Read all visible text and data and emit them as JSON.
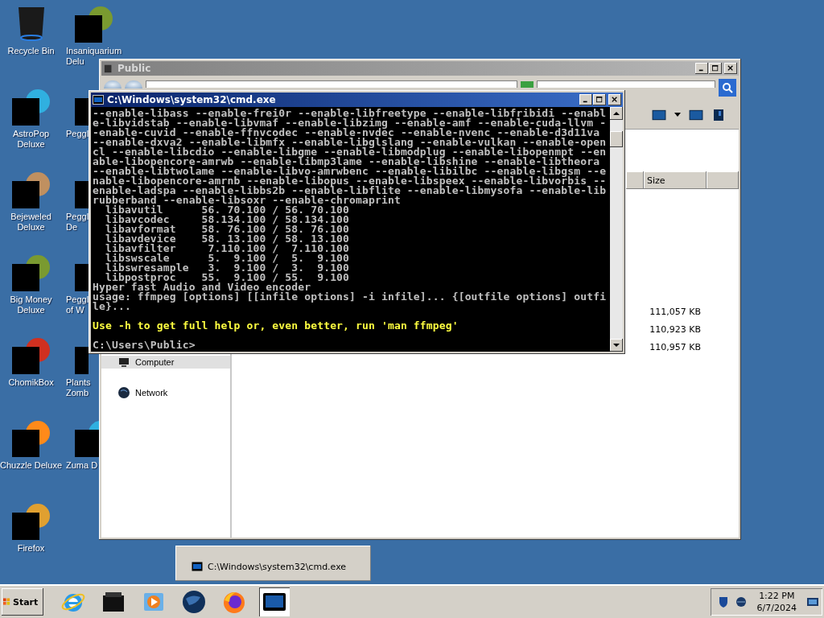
{
  "desktop_columns": [
    {
      "icons": [
        {
          "kind": "bin",
          "label": [
            "Recycle Bin"
          ]
        },
        {
          "kind": "redacted",
          "label": [
            "AstroPop",
            "Deluxe"
          ]
        },
        {
          "kind": "redacted",
          "label": [
            "Bejeweled",
            "Deluxe"
          ]
        },
        {
          "kind": "redacted",
          "label": [
            "Big Money",
            "Deluxe"
          ]
        },
        {
          "kind": "redacted",
          "label": [
            "ChomikBox"
          ]
        },
        {
          "kind": "redacted",
          "label": [
            "Chuzzle Deluxe"
          ]
        },
        {
          "kind": "redacted",
          "label": [
            "Firefox"
          ]
        }
      ]
    },
    {
      "icons": [
        {
          "kind": "redacted",
          "label": [
            "Insaniquarium",
            "Delu"
          ]
        },
        {
          "kind": "redacted",
          "label": [
            "Peggl"
          ]
        },
        {
          "kind": "redacted",
          "label": [
            "Peggl",
            "De"
          ]
        },
        {
          "kind": "redacted",
          "label": [
            "Peggl",
            "of W"
          ]
        },
        {
          "kind": "redacted",
          "label": [
            "Plants",
            "Zomb"
          ]
        },
        {
          "kind": "redacted",
          "label": [
            "Zuma D"
          ]
        }
      ]
    }
  ],
  "explorer": {
    "title": "Public",
    "active": false,
    "nav": [
      {
        "label": "Computer",
        "selected": true
      },
      {
        "label": "Network",
        "selected": false
      }
    ],
    "columns": [
      {
        "label": "Size"
      }
    ],
    "rows": [
      {
        "size": "111,057 KB"
      },
      {
        "size": "110,923 KB"
      },
      {
        "size": "110,957 KB"
      }
    ]
  },
  "cmd": {
    "title": "C:\\Windows\\system32\\cmd.exe",
    "active": true,
    "lines": [
      {
        "kind": "output",
        "text": "--enable-libass --enable-frei0r --enable-libfreetype --enable-libfribidi --enabl"
      },
      {
        "kind": "output",
        "text": "e-libvidstab --enable-libvmaf --enable-libzimg --enable-amf --enable-cuda-llvm -"
      },
      {
        "kind": "output",
        "text": "-enable-cuvid --enable-ffnvcodec --enable-nvdec --enable-nvenc --enable-d3d11va"
      },
      {
        "kind": "output",
        "text": "--enable-dxva2 --enable-libmfx --enable-libglslang --enable-vulkan --enable-open"
      },
      {
        "kind": "output",
        "text": "cl --enable-libcdio --enable-libgme --enable-libmodplug --enable-libopenmpt --en"
      },
      {
        "kind": "output",
        "text": "able-libopencore-amrwb --enable-libmp3lame --enable-libshine --enable-libtheora"
      },
      {
        "kind": "output",
        "text": "--enable-libtwolame --enable-libvo-amrwbenc --enable-libilbc --enable-libgsm --e"
      },
      {
        "kind": "output",
        "text": "nable-libopencore-amrnb --enable-libopus --enable-libspeex --enable-libvorbis --"
      },
      {
        "kind": "output",
        "text": "enable-ladspa --enable-libbs2b --enable-libflite --enable-libmysofa --enable-lib"
      },
      {
        "kind": "output",
        "text": "rubberband --enable-libsoxr --enable-chromaprint"
      },
      {
        "kind": "output",
        "text": "  libavutil      56. 70.100 / 56. 70.100"
      },
      {
        "kind": "output",
        "text": "  libavcodec     58.134.100 / 58.134.100"
      },
      {
        "kind": "output",
        "text": "  libavformat    58. 76.100 / 58. 76.100"
      },
      {
        "kind": "output",
        "text": "  libavdevice    58. 13.100 / 58. 13.100"
      },
      {
        "kind": "output",
        "text": "  libavfilter     7.110.100 /  7.110.100"
      },
      {
        "kind": "output",
        "text": "  libswscale      5.  9.100 /  5.  9.100"
      },
      {
        "kind": "output",
        "text": "  libswresample   3.  9.100 /  3.  9.100"
      },
      {
        "kind": "output",
        "text": "  libpostproc    55.  9.100 / 55.  9.100"
      },
      {
        "kind": "output",
        "text": "Hyper fast Audio and Video encoder"
      },
      {
        "kind": "output",
        "text": "usage: ffmpeg [options] [[infile options] -i infile]... {[outfile options] outfi"
      },
      {
        "kind": "output",
        "text": "le}..."
      },
      {
        "kind": "highlight",
        "text": "Use -h to get full help or, even better, run 'man ffmpeg'"
      },
      {
        "kind": "prompt",
        "text": "C:\\Users\\Public>"
      }
    ]
  },
  "preview": {
    "title": "C:\\Windows\\system32\\cmd.exe"
  },
  "taskbar": {
    "start": "Start",
    "apps": [
      {
        "kind": "browser-e",
        "selected": false
      },
      {
        "kind": "box",
        "selected": false
      },
      {
        "kind": "media",
        "selected": false
      },
      {
        "kind": "globe",
        "selected": false
      },
      {
        "kind": "fox",
        "selected": false
      },
      {
        "kind": "console",
        "selected": true
      }
    ],
    "time": "1:22 PM",
    "date": "6/7/2024"
  }
}
